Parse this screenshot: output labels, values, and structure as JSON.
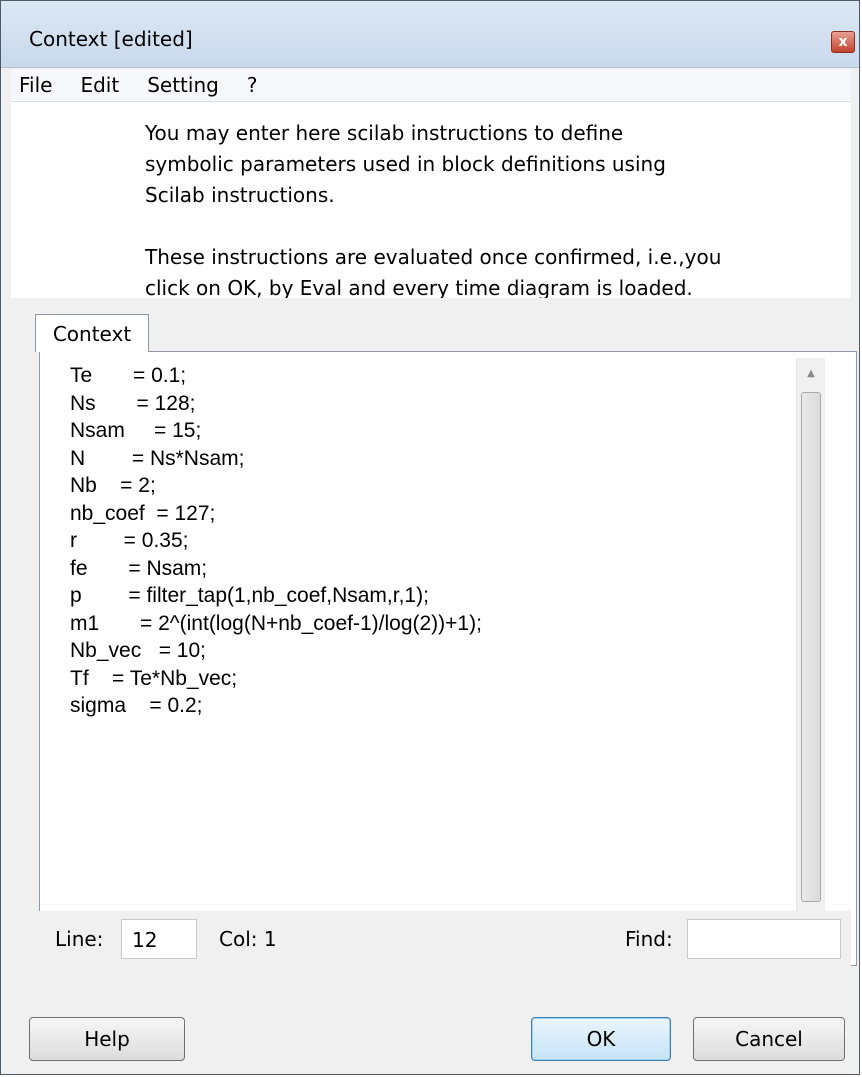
{
  "window": {
    "title": "Context [edited]",
    "close_glyph": "x"
  },
  "menu": [
    "File",
    "Edit",
    "Setting",
    "?"
  ],
  "info": {
    "lines": [
      "You may enter here scilab instructions to define",
      "symbolic parameters used in block definitions using",
      "Scilab instructions.",
      "",
      "These instructions are evaluated once confirmed, i.e.,you",
      "click on OK, by Eval and every time diagram is loaded."
    ]
  },
  "tab": {
    "label": "Context"
  },
  "editor": {
    "lines": [
      "Te       = 0.1;",
      "Ns       = 128;",
      "Nsam     = 15;",
      "N        = Ns*Nsam;",
      "Nb    = 2;",
      "nb_coef  = 127;",
      "r        = 0.35;",
      "fe       = Nsam;",
      "p        = filter_tap(1,nb_coef,Nsam,r,1);",
      "m1       = 2^(int(log(N+nb_coef-1)/log(2))+1);",
      "Nb_vec   = 10;",
      "Tf    = Te*Nb_vec;",
      "sigma    = 0.2;"
    ]
  },
  "status": {
    "line_label": "Line:",
    "line_value": "12",
    "col_label": "Col: 1",
    "find_label": "Find:",
    "find_value": ""
  },
  "buttons": {
    "help": "Help",
    "ok": "OK",
    "cancel": "Cancel"
  }
}
